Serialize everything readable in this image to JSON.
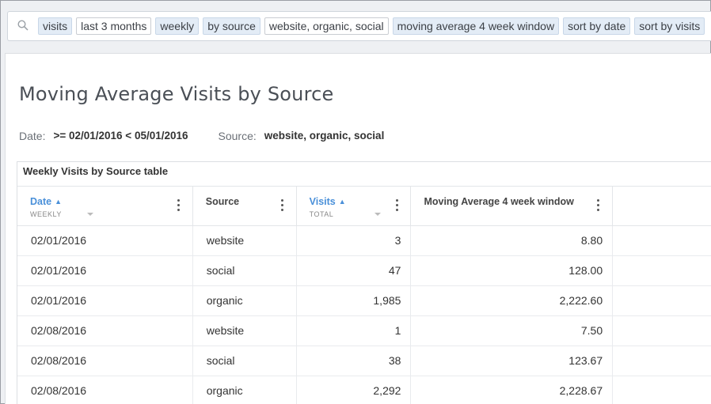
{
  "search": {
    "tokens": [
      {
        "label": "visits",
        "style": "blue"
      },
      {
        "label": "last 3 months",
        "style": "white"
      },
      {
        "label": "weekly",
        "style": "blue"
      },
      {
        "label": "by source",
        "style": "blue"
      },
      {
        "label": "website, organic, social",
        "style": "white"
      },
      {
        "label": "moving average 4 week window",
        "style": "blue"
      },
      {
        "label": "sort by date",
        "style": "blue"
      },
      {
        "label": "sort by visits",
        "style": "blue"
      }
    ]
  },
  "page": {
    "title": "Moving Average Visits by Source",
    "filters": {
      "date_label": "Date:",
      "date_value": ">= 02/01/2016 < 05/01/2016",
      "source_label": "Source:",
      "source_value": "website, organic, social"
    }
  },
  "table": {
    "title": "Weekly Visits by Source table",
    "columns": [
      {
        "label": "Date",
        "sub": "WEEKLY",
        "sorted": true
      },
      {
        "label": "Source",
        "sub": "",
        "sorted": false
      },
      {
        "label": "Visits",
        "sub": "TOTAL",
        "sorted": true
      },
      {
        "label": "Moving Average 4 week window",
        "sub": "",
        "sorted": false
      }
    ],
    "rows": [
      {
        "date": "02/01/2016",
        "source": "website",
        "visits": "3",
        "ma": "8.80"
      },
      {
        "date": "02/01/2016",
        "source": "social",
        "visits": "47",
        "ma": "128.00"
      },
      {
        "date": "02/01/2016",
        "source": "organic",
        "visits": "1,985",
        "ma": "2,222.60"
      },
      {
        "date": "02/08/2016",
        "source": "website",
        "visits": "1",
        "ma": "7.50"
      },
      {
        "date": "02/08/2016",
        "source": "social",
        "visits": "38",
        "ma": "123.67"
      },
      {
        "date": "02/08/2016",
        "source": "organic",
        "visits": "2,292",
        "ma": "2,228.67"
      }
    ]
  },
  "icons": {
    "search": "search-icon",
    "column_menu": "kebab-menu-icon",
    "sort": "sort-up-icon"
  },
  "colors": {
    "accent": "#4a90d9",
    "token_blue": "#e3ecf6"
  }
}
